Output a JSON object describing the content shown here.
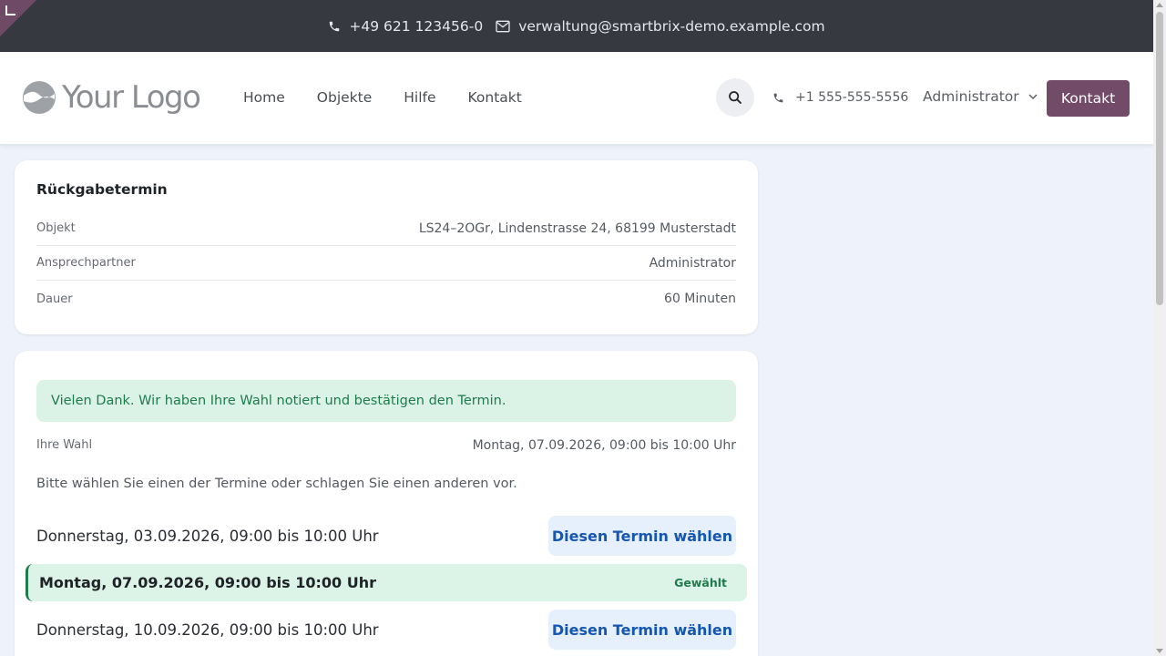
{
  "topbar": {
    "phone": "+49 621 123456-0",
    "email": "verwaltung@smartbrix-demo.example.com"
  },
  "header": {
    "logo_text": "Your Logo",
    "nav": [
      "Home",
      "Objekte",
      "Hilfe",
      "Kontakt"
    ],
    "phone": "+1 555-555-5556",
    "user": "Administrator",
    "cta": "Kontakt"
  },
  "appointment": {
    "title": "Rückgabetermin",
    "rows": [
      {
        "label": "Objekt",
        "value": "LS24–2OGr, Lindenstrasse 24, 68199 Musterstadt"
      },
      {
        "label": "Ansprechpartner",
        "value": "Administrator"
      },
      {
        "label": "Dauer",
        "value": "60 Minuten"
      }
    ]
  },
  "selection": {
    "alert": "Vielen Dank. Wir haben Ihre Wahl notiert und bestätigen den Termin.",
    "choice_label": "Ihre Wahl",
    "choice_value": "Montag, 07.09.2026, 09:00 bis 10:00 Uhr",
    "hint": "Bitte wählen Sie einen der Termine oder schlagen Sie einen anderen vor.",
    "slots": [
      {
        "date": "Donnerstag, 03.09.2026, 09:00 bis 10:00 Uhr",
        "button": "Diesen Termin wählen"
      },
      {
        "date": "Montag, 07.09.2026, 09:00 bis 10:00 Uhr",
        "badge": "Gewählt"
      },
      {
        "date": "Donnerstag, 10.09.2026, 09:00 bis 10:00 Uhr",
        "button": "Diesen Termin wählen"
      }
    ]
  },
  "colors": {
    "topbar": "#363a40",
    "brand": "#714b67",
    "success": "#1f7a4c",
    "link": "#1556b0"
  },
  "icons": [
    "phone-icon",
    "mail-icon",
    "search-icon",
    "chevron-down-icon"
  ]
}
